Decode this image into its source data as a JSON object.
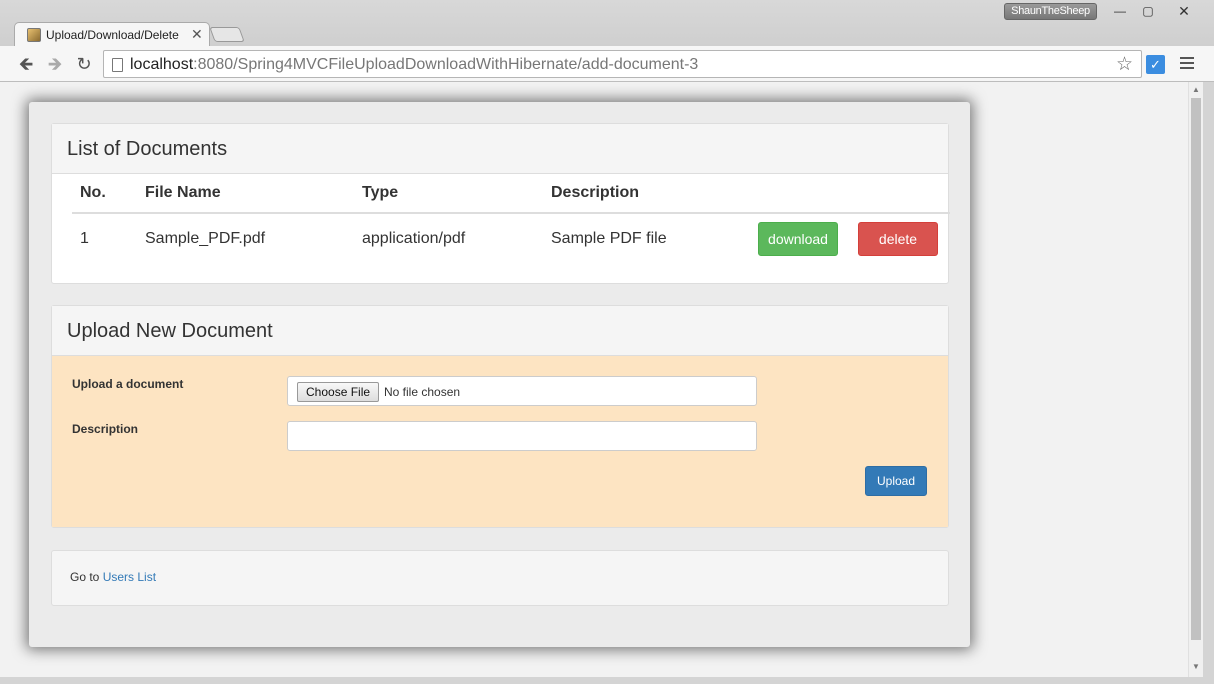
{
  "browser": {
    "user": "ShaunTheSheep",
    "tab_title": "Upload/Download/Delete",
    "url_host": "localhost",
    "url_path": ":8080/Spring4MVCFileUploadDownloadWithHibernate/add-document-3"
  },
  "documents_panel": {
    "heading": "List of Documents",
    "columns": [
      "No.",
      "File Name",
      "Type",
      "Description"
    ],
    "rows": [
      {
        "no": "1",
        "file_name": "Sample_PDF.pdf",
        "type": "application/pdf",
        "description": "Sample PDF file"
      }
    ],
    "download_label": "download",
    "delete_label": "delete"
  },
  "upload_panel": {
    "heading": "Upload New Document",
    "file_label": "Upload a document",
    "choose_file_label": "Choose File",
    "file_status": "No file chosen",
    "description_label": "Description",
    "description_value": "",
    "upload_label": "Upload"
  },
  "footer": {
    "prefix": "Go to",
    "link_label": "Users List"
  },
  "colors": {
    "download": "#5cb85c",
    "delete": "#d9534f",
    "upload": "#337ab7",
    "form_bg": "#fde4c2"
  }
}
